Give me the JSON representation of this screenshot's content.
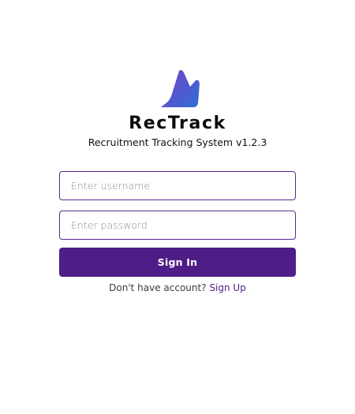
{
  "brand": {
    "name": "RecTrack",
    "tagline": "Recruitment Tracking System v1.2.3",
    "logo_icon": "rectrack-logo-icon",
    "logo_gradient": [
      "#6b3fd0",
      "#2f6fd6"
    ]
  },
  "login": {
    "username_placeholder": "Enter username",
    "username_value": "",
    "password_placeholder": "Enter password",
    "password_value": "",
    "signin_label": "Sign In",
    "signup_prompt": "Don't have account?",
    "signup_link": "Sign Up"
  },
  "colors": {
    "accent": "#4e1d87",
    "input_border": "#5a2a8c",
    "background": "#ffffff"
  }
}
